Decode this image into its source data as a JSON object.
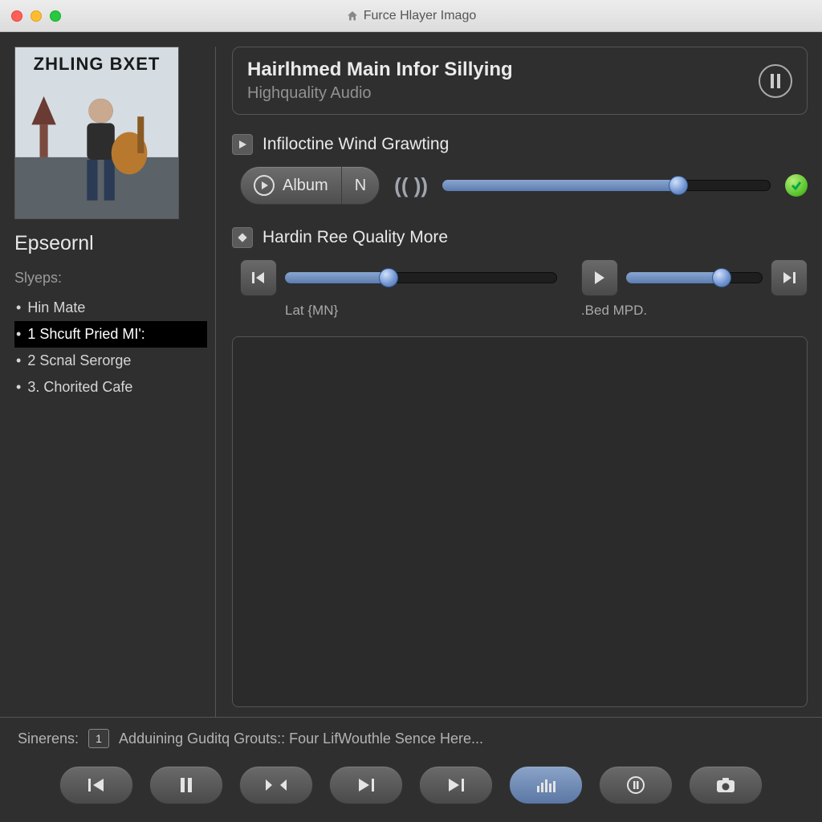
{
  "window": {
    "title": "Furce Hlayer Imago"
  },
  "sidebar": {
    "album_banner": "ZHLING BXET",
    "title": "Epseornl",
    "list_header": "Slyeps:",
    "tracks": [
      {
        "label": "Hin Mate",
        "selected": false
      },
      {
        "label": "1 Shcuft Pried MI':",
        "selected": true
      },
      {
        "label": "2 Scnal Serorge",
        "selected": false
      },
      {
        "label": "3. Chorited Cafe",
        "selected": false
      }
    ]
  },
  "main": {
    "header_title": "Hairlhmed Main Infor Sillying",
    "header_subtitle": "Highquality Audio",
    "section1_label": "Infiloctine Wind Grawting",
    "album_button_label": "Album",
    "n_button_label": "N",
    "volume_percent": 72,
    "section2_label": "Hardin Ree Quality More",
    "track_a": {
      "label": "Lat {MN}",
      "position_percent": 38
    },
    "track_b": {
      "label": ".Bed MPD.",
      "position_percent": 70
    }
  },
  "status": {
    "label": "Sinerens:",
    "chip": "1",
    "text": "Adduining Guditq Grouts:: Four LifWouthle Sence Here..."
  },
  "toolbar_icons": [
    "prev",
    "pause",
    "shuffle",
    "next",
    "next2",
    "eq",
    "stop-circle",
    "camera"
  ],
  "colors": {
    "accent": "#6f93cf",
    "bg": "#2f2f2f"
  }
}
